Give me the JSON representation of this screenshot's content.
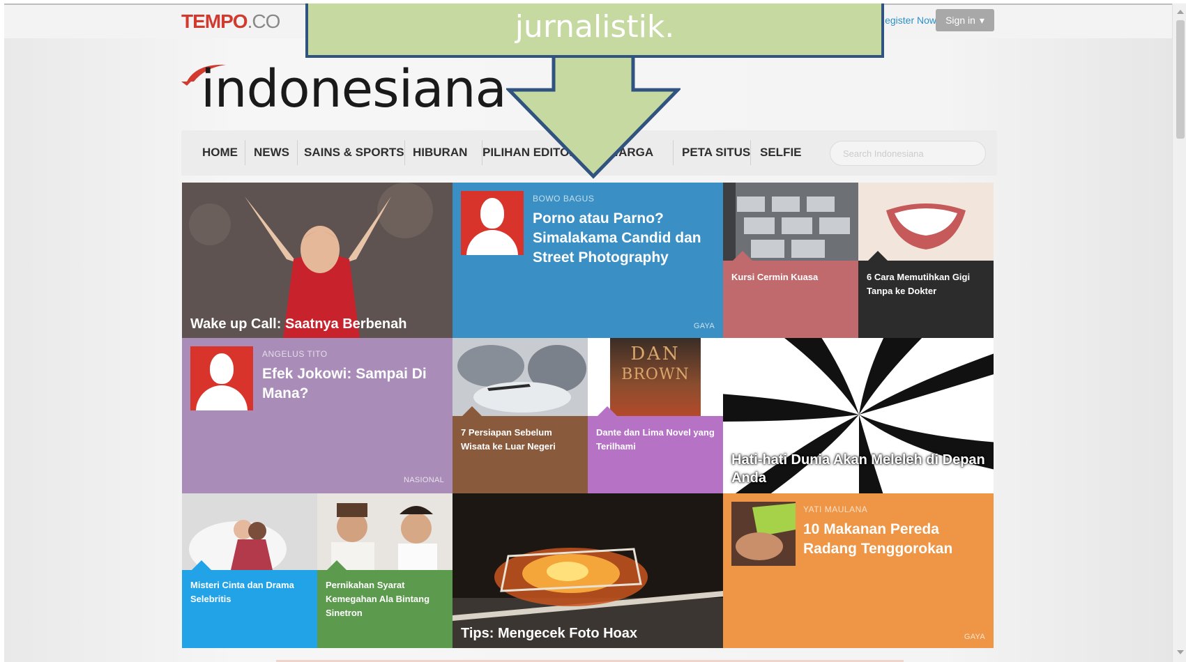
{
  "callout": {
    "text": "jurnalistik."
  },
  "topbar": {
    "brand_main": "TEMPO",
    "brand_suffix": ".CO",
    "register": "Register Now!",
    "signin": "Sign in",
    "signin_caret": "▾"
  },
  "site": {
    "logo_text": "indonesiana"
  },
  "nav": {
    "items": [
      "HOME",
      "NEWS",
      "SAINS & SPORTS",
      "HIBURAN",
      "PILIHAN EDITOR",
      "WARGA",
      "PETA SITUS",
      "SELFIE"
    ],
    "search_placeholder": "Search Indonesiana"
  },
  "tiles": {
    "robben": {
      "title": "Wake up Call: Saatnya Berbenah"
    },
    "porno": {
      "author": "BOWO BAGUS",
      "title": "Porno atau Parno? Simalakama Candid dan Street Photography",
      "category": "GAYA"
    },
    "kursi": {
      "title": "Kursi Cermin Kuasa"
    },
    "gigi": {
      "title": "6 Cara Memutihkan Gigi Tanpa ke Dokter"
    },
    "jokowi": {
      "author": "ANGELUS TITO",
      "title": "Efek Jokowi: Sampai Di Mana?",
      "category": "NASIONAL"
    },
    "wisata": {
      "title": "7 Persiapan Sebelum Wisata ke Luar Negeri"
    },
    "dante": {
      "title": "Dante dan Lima Novel yang Terilhami",
      "book_line1": "DAN",
      "book_line2": "BROWN"
    },
    "dunia": {
      "title": "Hati-hati Dunia Akan Meleleh di Depan Anda"
    },
    "misteri": {
      "title": "Misteri Cinta dan Drama Selebritis"
    },
    "pernikahan": {
      "title": "Pernikahan Syarat Kemegahan Ala Bintang Sinetron"
    },
    "hoax": {
      "title": "Tips: Mengecek Foto Hoax"
    },
    "makanan": {
      "author": "YATI MAULANA",
      "title": "10 Makanan Pereda Radang Tenggorokan",
      "category": "GAYA"
    }
  },
  "colors": {
    "blue_tile": "#3a8fc4",
    "purple_tile": "#a98db8",
    "rose_tile": "#c06a6e",
    "dark_tile": "#2c2c2c",
    "brown_tile": "#8a5a3c",
    "magenta_tile": "#b673c6",
    "sky_tile": "#22a3e8",
    "green_tile": "#5c9a4e",
    "orange_tile": "#ee9645",
    "callout_fill": "#c5d9a1",
    "callout_border": "#30537f"
  }
}
